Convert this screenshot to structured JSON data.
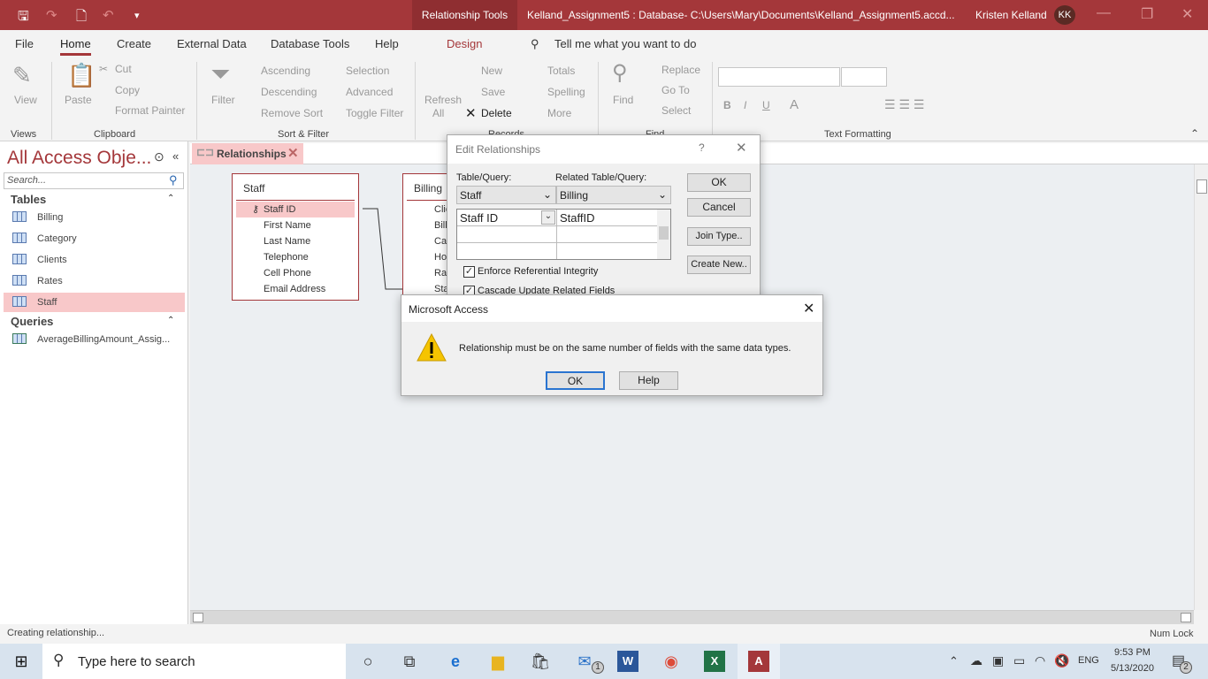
{
  "titlebar": {
    "context_tab": "Relationship Tools",
    "document": "Kelland_Assignment5 : Database- C:\\Users\\Mary\\Documents\\Kelland_Assignment5.accd...",
    "user": "Kristen Kelland",
    "initials": "KK",
    "accent": "#a4373a"
  },
  "menu": {
    "file": "File",
    "home": "Home",
    "create": "Create",
    "external": "External Data",
    "dbtools": "Database Tools",
    "help": "Help",
    "design": "Design",
    "tell": "Tell me what you want to do"
  },
  "ribbon": {
    "view": "View",
    "views": "Views",
    "paste": "Paste",
    "cut": "Cut",
    "copy": "Copy",
    "format_painter": "Format Painter",
    "clipboard": "Clipboard",
    "filter": "Filter",
    "ascending": "Ascending",
    "descending": "Descending",
    "remove_sort": "Remove Sort",
    "selection": "Selection",
    "advanced": "Advanced",
    "toggle_filter": "Toggle Filter",
    "sort_filter": "Sort & Filter",
    "refresh": "Refresh",
    "all": "All",
    "new": "New",
    "save": "Save",
    "delete": "Delete",
    "totals": "Totals",
    "spelling": "Spelling",
    "more": "More",
    "records": "Records",
    "find": "Find",
    "replace": "Replace",
    "goto": "Go To",
    "select": "Select",
    "find_group": "Find",
    "bold": "B",
    "italic": "I",
    "underline": "U",
    "font_color": "A",
    "text_formatting": "Text Formatting"
  },
  "nav": {
    "title": "All Access Obje...",
    "search_placeholder": "Search...",
    "tables_header": "Tables",
    "tables": [
      "Billing",
      "Category",
      "Clients",
      "Rates",
      "Staff"
    ],
    "selected": "Staff",
    "queries_header": "Queries",
    "queries": [
      "AverageBillingAmount_Assig..."
    ]
  },
  "doc_tab": {
    "label": "Relationships"
  },
  "staff_table": {
    "title": "Staff",
    "fields": [
      "Staff ID",
      "First Name",
      "Last Name",
      "Telephone",
      "Cell Phone",
      "Email Address"
    ]
  },
  "billing_table": {
    "title": "Billing",
    "fields": [
      "Clie",
      "Bill",
      "Cat",
      "Ho",
      "Rat",
      "Sta"
    ]
  },
  "edit_rel": {
    "title": "Edit Relationships",
    "help": "?",
    "table_label": "Table/Query:",
    "related_label": "Related Table/Query:",
    "table": "Staff",
    "related": "Billing",
    "field": "Staff ID",
    "related_field": "StaffID",
    "enforce": "Enforce Referential Integrity",
    "cascade": "Cascade Update Related Fields",
    "ok": "OK",
    "cancel": "Cancel",
    "join": "Join Type..",
    "create": "Create New.."
  },
  "msg": {
    "title": "Microsoft Access",
    "text": "Relationship must be on the same number of fields with the same data types.",
    "ok": "OK",
    "help": "Help"
  },
  "status": {
    "left": "Creating relationship...",
    "right": "Num Lock"
  },
  "taskbar": {
    "search": "Type here to search",
    "lang": "ENG",
    "time": "9:53 PM",
    "date": "5/13/2020",
    "mail_badge": "1",
    "notif_badge": "2"
  }
}
